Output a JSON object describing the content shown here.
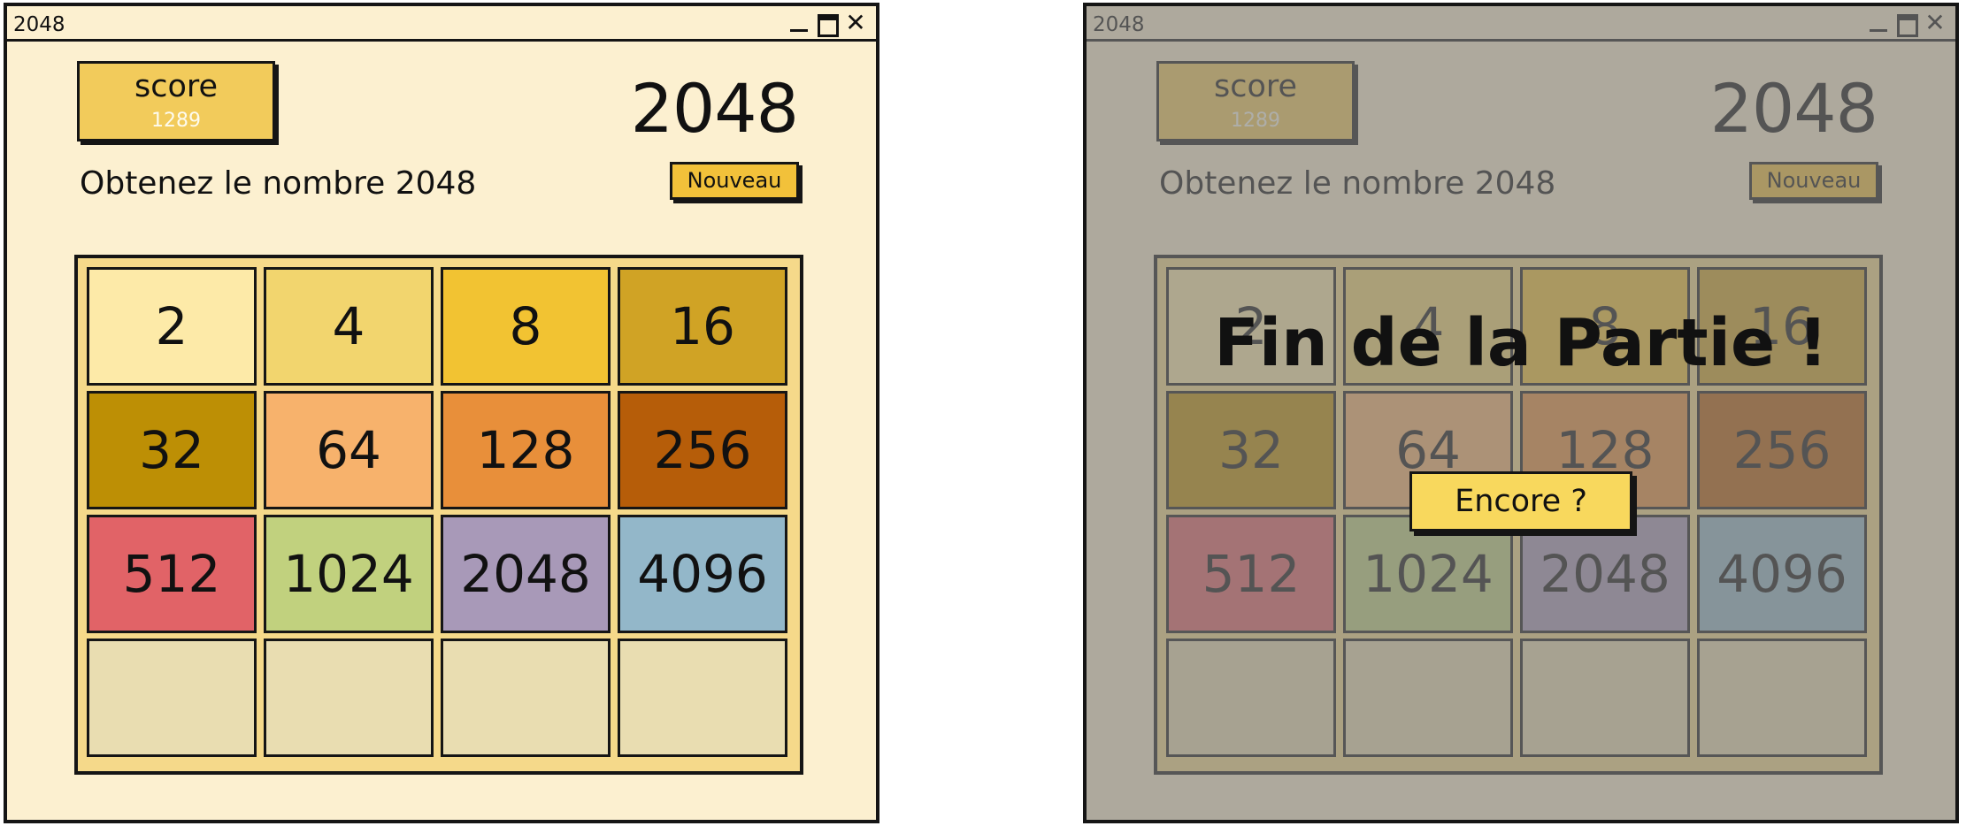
{
  "window_title": "2048",
  "score": {
    "label": "score",
    "value": "1289"
  },
  "game_title": "2048",
  "subtitle": "Obtenez le nombre 2048",
  "new_button": "Nouveau",
  "tiles": [
    "2",
    "4",
    "8",
    "16",
    "32",
    "64",
    "128",
    "256",
    "512",
    "1024",
    "2048",
    "4096",
    "",
    "",
    "",
    ""
  ],
  "tile_colors": [
    "#fdeaa8",
    "#f2d56e",
    "#f2c332",
    "#d0a325",
    "#bd8f05",
    "#f7b26c",
    "#e88f3a",
    "#b65d09",
    "#e16367",
    "#c1d17e",
    "#a899b8",
    "#93b7c9",
    "#e9ddb1",
    "#e9ddb1",
    "#e9ddb1",
    "#e9ddb1"
  ],
  "game_over": {
    "message": "Fin de la Partie !",
    "again_button": "Encore ?"
  }
}
